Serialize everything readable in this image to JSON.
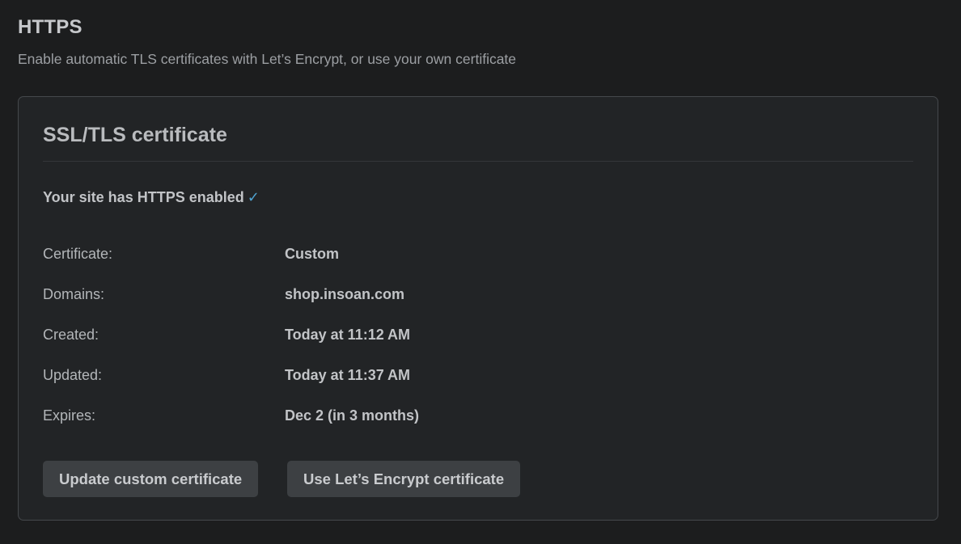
{
  "section": {
    "title": "HTTPS",
    "description": "Enable automatic TLS certificates with Let’s Encrypt, or use your own certificate"
  },
  "card": {
    "title": "SSL/TLS certificate",
    "status_text": "Your site has HTTPS enabled",
    "status_icon": "checkmark-icon",
    "status_glyph": "✓",
    "accent_color": "#4fa3d1",
    "details": [
      {
        "label": "Certificate:",
        "value": "Custom"
      },
      {
        "label": "Domains:",
        "value": "shop.insoan.com"
      },
      {
        "label": "Created:",
        "value": "Today at 11:12 AM"
      },
      {
        "label": "Updated:",
        "value": "Today at 11:37 AM"
      },
      {
        "label": "Expires:",
        "value": "Dec 2 (in 3 months)"
      }
    ],
    "buttons": {
      "update_custom": "Update custom certificate",
      "use_letsencrypt": "Use Let’s Encrypt certificate"
    }
  }
}
